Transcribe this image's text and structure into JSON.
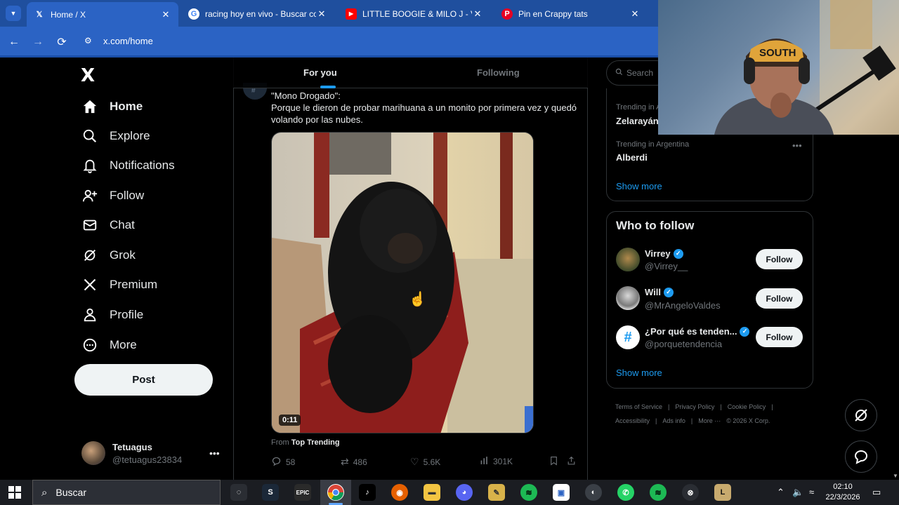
{
  "browser": {
    "tabs": [
      {
        "title": "Home / X",
        "favicon": "x-logo"
      },
      {
        "title": "racing hoy en vivo - Buscar con",
        "favicon": "google-logo"
      },
      {
        "title": "LITTLE BOOGIE & MILO J - VOY",
        "favicon": "youtube-logo"
      },
      {
        "title": "Pin en Crappy tats",
        "favicon": "pinterest-logo"
      }
    ],
    "url": "x.com/home"
  },
  "sidebar": {
    "logo": "X",
    "items": [
      {
        "label": "Home",
        "icon": "home-icon"
      },
      {
        "label": "Explore",
        "icon": "search-icon"
      },
      {
        "label": "Notifications",
        "icon": "bell-icon"
      },
      {
        "label": "Follow",
        "icon": "add-person-icon"
      },
      {
        "label": "Chat",
        "icon": "mail-icon"
      },
      {
        "label": "Grok",
        "icon": "grok-icon"
      },
      {
        "label": "Premium",
        "icon": "x-icon"
      },
      {
        "label": "Profile",
        "icon": "person-icon"
      },
      {
        "label": "More",
        "icon": "more-circle-icon"
      }
    ],
    "post_label": "Post",
    "account": {
      "name": "Tetuagus",
      "handle": "@tetuagus23834"
    }
  },
  "feed": {
    "tabs": [
      "For you",
      "Following"
    ],
    "tweet": {
      "text_title": "\"Mono Drogado\":",
      "text_body": "Porque le dieron de probar marihuana a un monito por primera vez y quedó volando por las nubes.",
      "video_duration": "0:11",
      "from_prefix": "From",
      "from_source": "Top Trending",
      "replies": "58",
      "reposts": "486",
      "likes": "5.6K",
      "views": "301K"
    }
  },
  "right": {
    "search_placeholder": "Search",
    "trends": [
      {
        "meta": "Trending in A",
        "name": "Zelarayán"
      },
      {
        "meta": "Trending in Argentina",
        "name": "Alberdi"
      }
    ],
    "trends_show_more": "Show more",
    "who_to_follow": {
      "title": "Who to follow",
      "accounts": [
        {
          "name": "Virrey",
          "handle": "@Virrey__",
          "button": "Follow"
        },
        {
          "name": "Will",
          "handle": "@MrAngeloValdes",
          "button": "Follow"
        },
        {
          "name": "¿Por qué es tenden...",
          "handle": "@porquetendencia",
          "button": "Follow"
        }
      ],
      "show_more": "Show more"
    },
    "footer": [
      "Terms of Service",
      "|",
      "Privacy Policy",
      "|",
      "Cookie Policy",
      "|",
      "Accessibility",
      "|",
      "Ads info",
      "|",
      "More ···",
      "© 2026 X Corp."
    ]
  },
  "webcam": {
    "cap_text": "SOUTH"
  },
  "taskbar": {
    "search_label": "Buscar",
    "time": "02:10",
    "date": "22/3/2026"
  },
  "colors": {
    "accent": "#1d9bf0",
    "chrome": "#2b63c4",
    "background": "#000000"
  }
}
